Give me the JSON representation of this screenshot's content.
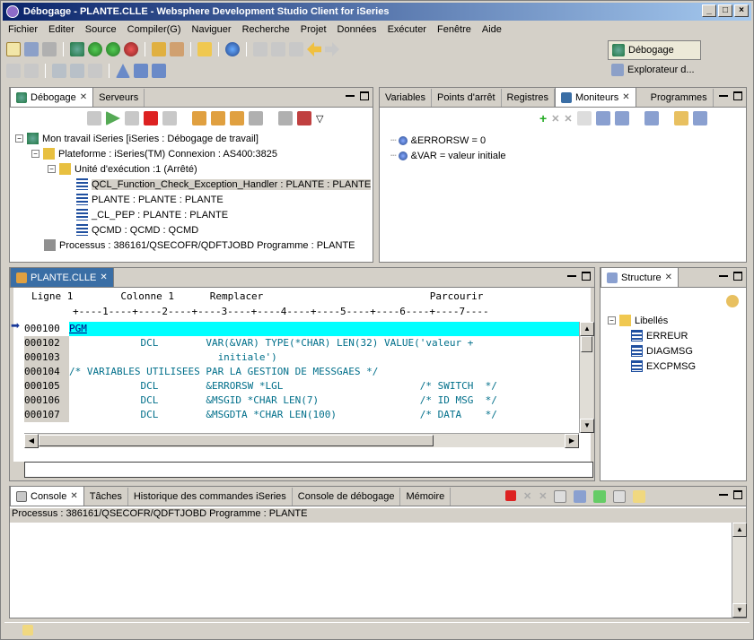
{
  "window": {
    "title": "Débogage - PLANTE.CLLE - Websphere Development Studio Client for iSeries"
  },
  "menu": [
    "Fichier",
    "Editer",
    "Source",
    "Compiler(G)",
    "Naviguer",
    "Recherche",
    "Projet",
    "Données",
    "Exécuter",
    "Fenêtre",
    "Aide"
  ],
  "perspectives": {
    "debug": "Débogage",
    "explorer": "Explorateur d..."
  },
  "debug_panel": {
    "tabs": [
      "Débogage",
      "Serveurs"
    ],
    "tree": [
      {
        "label": "Mon travail iSeries [iSeries : Débogage de travail]",
        "indent": 0
      },
      {
        "label": "Plateforme : iSeries(TM)   Connexion : AS400:3825",
        "indent": 1
      },
      {
        "label": "Unité d'exécution :1 (Arrêté)",
        "indent": 2
      },
      {
        "label": "QCL_Function_Check_Exception_Handler : PLANTE : PLANTE",
        "indent": 3
      },
      {
        "label": "PLANTE : PLANTE : PLANTE",
        "indent": 3
      },
      {
        "label": "_CL_PEP : PLANTE : PLANTE",
        "indent": 3
      },
      {
        "label": "QCMD : QCMD : QCMD",
        "indent": 3
      },
      {
        "label": "Processus : 386161/QSECOFR/QDFTJOBD  Programme : PLANTE",
        "indent": 1
      }
    ]
  },
  "monitor_panel": {
    "tabs": [
      "Variables",
      "Points d'arrêt",
      "Registres",
      "Moniteurs",
      "Programmes"
    ],
    "items": [
      "&ERRORSW = 0",
      "&VAR = valeur initiale"
    ]
  },
  "editor": {
    "tab": "PLANTE.CLLE",
    "header": {
      "line": "Ligne 1",
      "column": "Colonne 1",
      "mode": "Remplacer",
      "browse": "Parcourir"
    },
    "ruler": "+----1----+----2----+----3----+----4----+----5----+----6----+----7----",
    "lines": [
      {
        "no": "000100",
        "text": "PGM"
      },
      {
        "no": "000102",
        "text": "            DCL        VAR(&VAR) TYPE(*CHAR) LEN(32) VALUE('valeur +"
      },
      {
        "no": "000103",
        "text": "                         initiale')"
      },
      {
        "no": "000104",
        "text": "/* VARIABLES UTILISEES PAR LA GESTION DE MESSGAES */"
      },
      {
        "no": "000105",
        "text": "            DCL        &ERRORSW *LGL                       /* SWITCH  */"
      },
      {
        "no": "000106",
        "text": "            DCL        &MSGID *CHAR LEN(7)                 /* ID MSG  */"
      },
      {
        "no": "000107",
        "text": "            DCL        &MSGDTA *CHAR LEN(100)              /* DATA    */"
      }
    ]
  },
  "structure_panel": {
    "tab": "Structure",
    "root": "Libellés",
    "items": [
      "ERREUR",
      "DIAGMSG",
      "EXCPMSG"
    ]
  },
  "console_panel": {
    "tabs": [
      "Console",
      "Tâches",
      "Historique des commandes iSeries",
      "Console de débogage",
      "Mémoire"
    ],
    "status": "Processus : 386161/QSECOFR/QDFTJOBD  Programme : PLANTE"
  },
  "colors": {
    "title_start": "#0a246a",
    "title_end": "#a6caf0",
    "highlight": "#00ffff",
    "code": "#006f8a",
    "keyword": "#000080"
  }
}
